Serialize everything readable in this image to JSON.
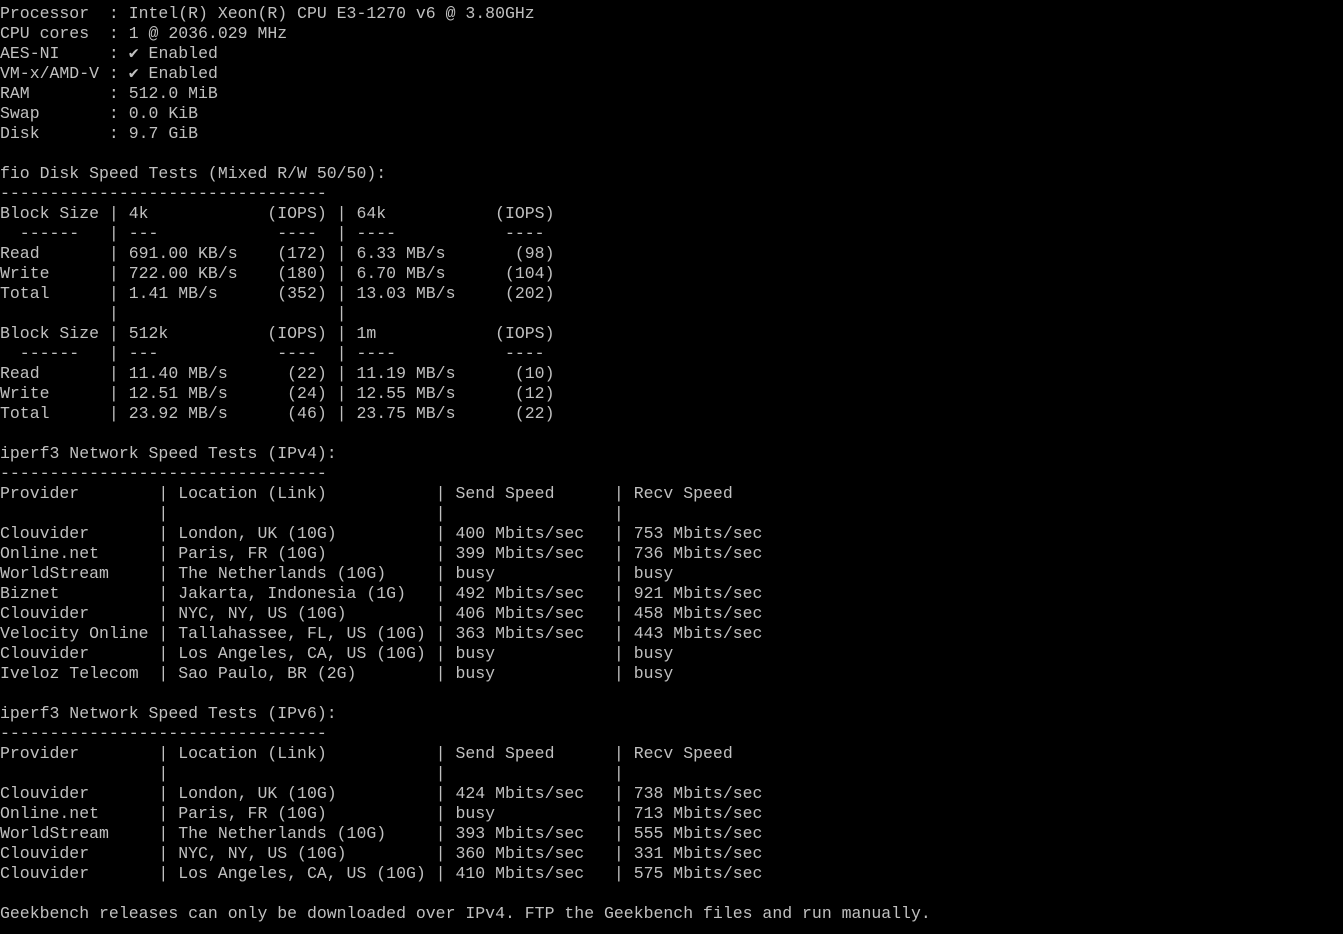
{
  "terminal": {
    "lines": [
      "Processor  : Intel(R) Xeon(R) CPU E3-1270 v6 @ 3.80GHz",
      "CPU cores  : 1 @ 2036.029 MHz",
      "AES-NI     : ✔ Enabled",
      "VM-x/AMD-V : ✔ Enabled",
      "RAM        : 512.0 MiB",
      "Swap       : 0.0 KiB",
      "Disk       : 9.7 GiB",
      "",
      "fio Disk Speed Tests (Mixed R/W 50/50):",
      "---------------------------------",
      "Block Size | 4k            (IOPS) | 64k           (IOPS)",
      "  ------   | ---            ----  | ----           ---- ",
      "Read       | 691.00 KB/s    (172) | 6.33 MB/s       (98)",
      "Write      | 722.00 KB/s    (180) | 6.70 MB/s      (104)",
      "Total      | 1.41 MB/s      (352) | 13.03 MB/s     (202)",
      "           |                      |                     ",
      "Block Size | 512k          (IOPS) | 1m            (IOPS)",
      "  ------   | ---            ----  | ----           ---- ",
      "Read       | 11.40 MB/s      (22) | 11.19 MB/s      (10)",
      "Write      | 12.51 MB/s      (24) | 12.55 MB/s      (12)",
      "Total      | 23.92 MB/s      (46) | 23.75 MB/s      (22)",
      "",
      "iperf3 Network Speed Tests (IPv4):",
      "---------------------------------",
      "Provider        | Location (Link)           | Send Speed      | Recv Speed     ",
      "                |                           |                 |                ",
      "Clouvider       | London, UK (10G)          | 400 Mbits/sec   | 753 Mbits/sec  ",
      "Online.net      | Paris, FR (10G)           | 399 Mbits/sec   | 736 Mbits/sec  ",
      "WorldStream     | The Netherlands (10G)     | busy            | busy           ",
      "Biznet          | Jakarta, Indonesia (1G)   | 492 Mbits/sec   | 921 Mbits/sec  ",
      "Clouvider       | NYC, NY, US (10G)         | 406 Mbits/sec   | 458 Mbits/sec  ",
      "Velocity Online | Tallahassee, FL, US (10G) | 363 Mbits/sec   | 443 Mbits/sec  ",
      "Clouvider       | Los Angeles, CA, US (10G) | busy            | busy           ",
      "Iveloz Telecom  | Sao Paulo, BR (2G)        | busy            | busy           ",
      "",
      "iperf3 Network Speed Tests (IPv6):",
      "---------------------------------",
      "Provider        | Location (Link)           | Send Speed      | Recv Speed     ",
      "                |                           |                 |                ",
      "Clouvider       | London, UK (10G)          | 424 Mbits/sec   | 738 Mbits/sec  ",
      "Online.net      | Paris, FR (10G)           | busy            | 713 Mbits/sec  ",
      "WorldStream     | The Netherlands (10G)     | 393 Mbits/sec   | 555 Mbits/sec  ",
      "Clouvider       | NYC, NY, US (10G)         | 360 Mbits/sec   | 331 Mbits/sec  ",
      "Clouvider       | Los Angeles, CA, US (10G) | 410 Mbits/sec   | 575 Mbits/sec  ",
      "",
      "Geekbench releases can only be downloaded over IPv4. FTP the Geekbench files and run manually."
    ]
  }
}
